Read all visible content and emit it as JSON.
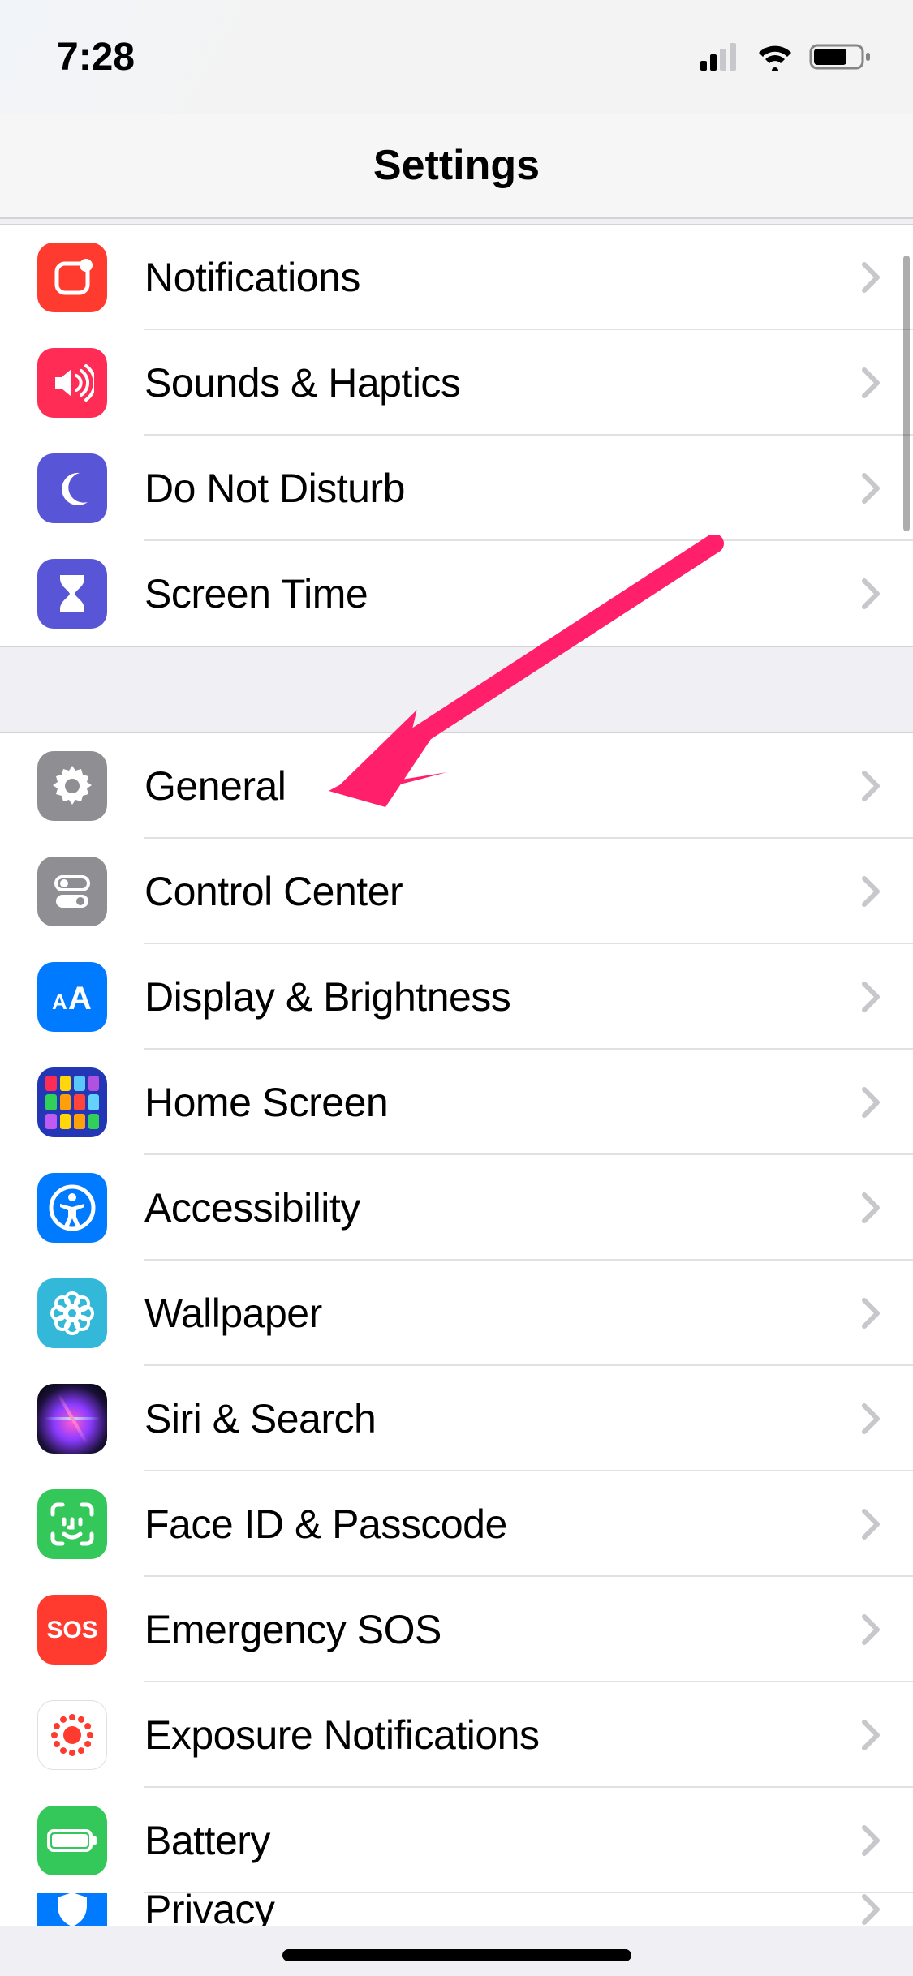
{
  "status": {
    "time": "7:28"
  },
  "header": {
    "title": "Settings"
  },
  "annotation": {
    "color": "#ff1f6b"
  },
  "groups": [
    {
      "items": [
        {
          "key": "notifications",
          "label": "Notifications",
          "iconBg": "bg-red",
          "icon": "notification-icon"
        },
        {
          "key": "sounds",
          "label": "Sounds & Haptics",
          "iconBg": "bg-pink",
          "icon": "speaker-icon"
        },
        {
          "key": "dnd",
          "label": "Do Not Disturb",
          "iconBg": "bg-indigo",
          "icon": "moon-icon"
        },
        {
          "key": "screentime",
          "label": "Screen Time",
          "iconBg": "bg-indigo",
          "icon": "hourglass-icon"
        }
      ]
    },
    {
      "items": [
        {
          "key": "general",
          "label": "General",
          "iconBg": "bg-gray",
          "icon": "gear-icon"
        },
        {
          "key": "controlcenter",
          "label": "Control Center",
          "iconBg": "bg-gray",
          "icon": "switches-icon"
        },
        {
          "key": "display",
          "label": "Display & Brightness",
          "iconBg": "bg-blue",
          "icon": "textsize-icon"
        },
        {
          "key": "homescreen",
          "label": "Home Screen",
          "iconBg": "bg-homescreen",
          "icon": "homescreen-icon"
        },
        {
          "key": "accessibility",
          "label": "Accessibility",
          "iconBg": "bg-blue",
          "icon": "accessibility-icon"
        },
        {
          "key": "wallpaper",
          "label": "Wallpaper",
          "iconBg": "bg-cyan",
          "icon": "flower-icon"
        },
        {
          "key": "siri",
          "label": "Siri & Search",
          "iconBg": "bg-siri siri-burst",
          "icon": "siri-icon"
        },
        {
          "key": "faceid",
          "label": "Face ID & Passcode",
          "iconBg": "bg-green",
          "icon": "faceid-icon"
        },
        {
          "key": "sos",
          "label": "Emergency SOS",
          "iconBg": "bg-orange",
          "icon": "sos-icon"
        },
        {
          "key": "exposure",
          "label": "Exposure Notifications",
          "iconBg": "bg-white-border",
          "icon": "exposure-icon"
        },
        {
          "key": "battery",
          "label": "Battery",
          "iconBg": "bg-green",
          "icon": "battery-icon"
        },
        {
          "key": "privacy",
          "label": "Privacy",
          "iconBg": "bg-blue",
          "icon": "privacy-icon",
          "partial": true
        }
      ]
    }
  ]
}
